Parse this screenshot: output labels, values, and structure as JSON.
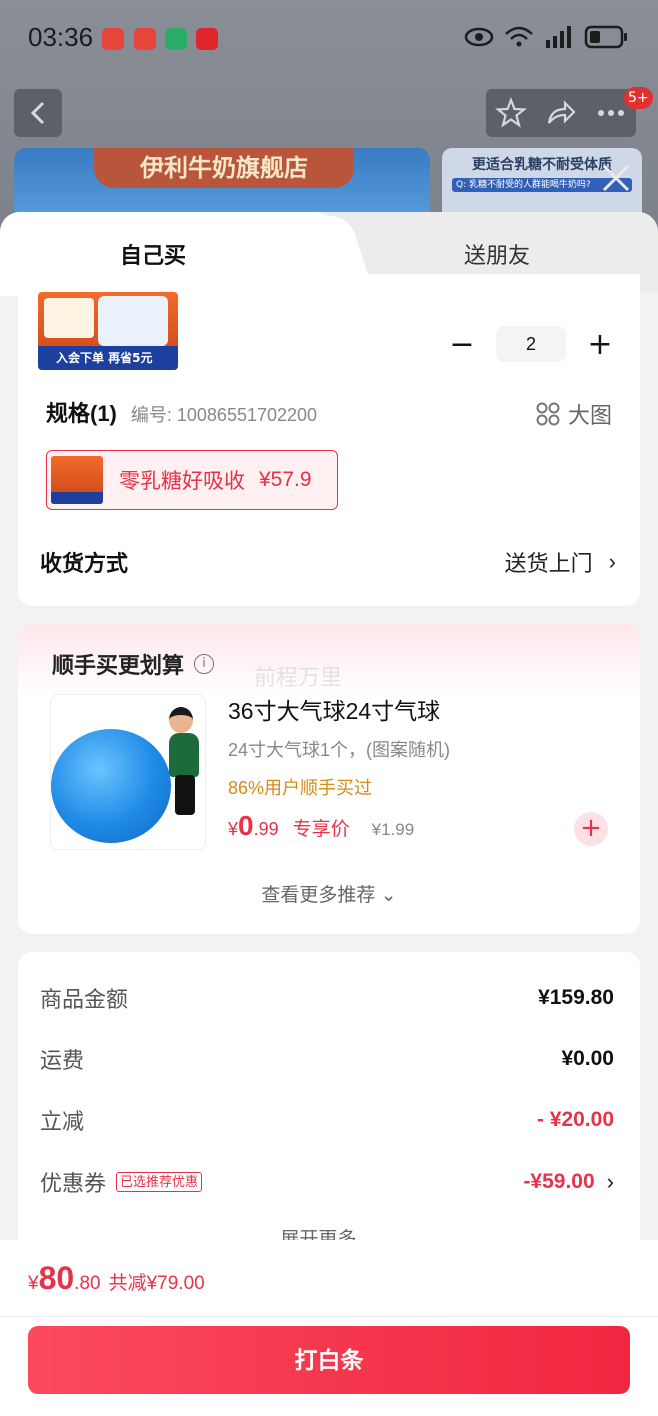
{
  "status_bar": {
    "time": "03:36",
    "app_icons": [
      {
        "name": "phone-missed-icon",
        "color": "#e8453c"
      },
      {
        "name": "taobao-icon",
        "color": "#e8453c"
      },
      {
        "name": "wechat-icon",
        "color": "#2aae67"
      },
      {
        "name": "jd-icon",
        "color": "#e0262a"
      }
    ]
  },
  "background": {
    "store_banner": "伊利牛奶旗舰店",
    "promo_card_title": "更适合乳糖不耐受体质",
    "promo_card_sub": "Q: 乳糖不耐受的人群能喝牛奶吗?",
    "badge": "5+"
  },
  "tabs": {
    "self_buy": "自己买",
    "gift": "送朋友"
  },
  "product": {
    "thumb_tag": "入会下单 再省5元",
    "quantity": "2",
    "minus": "−",
    "plus": "+",
    "spec_title": "规格(1)",
    "spec_code": "编号: 10086551702200",
    "big_image": "大图",
    "spec_option_label": "零乳糖好吸收",
    "spec_option_price": "¥57.9"
  },
  "delivery": {
    "label": "收货方式",
    "value": "送货上门",
    "chevron": "›"
  },
  "recommend": {
    "title": "顺手买更划算",
    "watermark": "前程万里",
    "item": {
      "name": "36寸大气球24寸气球",
      "desc": "24寸大气球1个，(图案随机)",
      "popularity": "86%用户顺手买过",
      "currency": "¥",
      "price_int": "0",
      "price_dec": ".99",
      "exclusive": "专享价",
      "original_price": "¥1.99"
    },
    "more": "查看更多推荐 ⌄"
  },
  "cost": {
    "rows": [
      {
        "label": "商品金额",
        "value": "¥159.80"
      },
      {
        "label": "运费",
        "value": "¥0.00"
      },
      {
        "label": "立减",
        "value": "- ¥20.00"
      },
      {
        "label": "优惠券",
        "tag": "已选推荐优惠",
        "value": "-¥59.00"
      }
    ],
    "expand": "展开更多 ⌄"
  },
  "footer": {
    "currency": "¥",
    "total_int": "80",
    "total_dec": ".80",
    "saving": "共减¥79.00",
    "pay_button": "打白条"
  },
  "colors": {
    "accent_red": "#e8324a",
    "popularity_orange": "#d78a1a"
  }
}
